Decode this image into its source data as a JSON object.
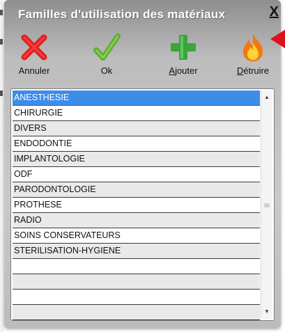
{
  "window": {
    "title": "Familles d'utilisation des matériaux",
    "close_label": "X"
  },
  "toolbar": {
    "buttons": [
      {
        "name": "annuler",
        "label": "Annuler",
        "icon": "cross-icon",
        "color": "#e02020"
      },
      {
        "name": "ok",
        "label": "Ok",
        "icon": "checkmark-icon",
        "color": "#5fae2e"
      },
      {
        "name": "ajouter",
        "label": "Ajouter",
        "icon": "plus-icon",
        "color": "#3aa53a"
      },
      {
        "name": "detruire",
        "label": "Détruire",
        "icon": "flame-icon",
        "color": "#f07a10"
      }
    ]
  },
  "list": {
    "items": [
      "ANESTHESIE",
      "CHIRURGIE",
      "DIVERS",
      "ENDODONTIE",
      "IMPLANTOLOGIE",
      "ODF",
      "PARODONTOLOGIE",
      "PROTHESE",
      "RADIO",
      "SOINS CONSERVATEURS",
      "STERILISATION-HYGIENE",
      "",
      "",
      "",
      ""
    ],
    "selected_index": 0
  },
  "colors": {
    "selection": "#3d8ce8",
    "annotation_arrow": "#e0101a"
  }
}
